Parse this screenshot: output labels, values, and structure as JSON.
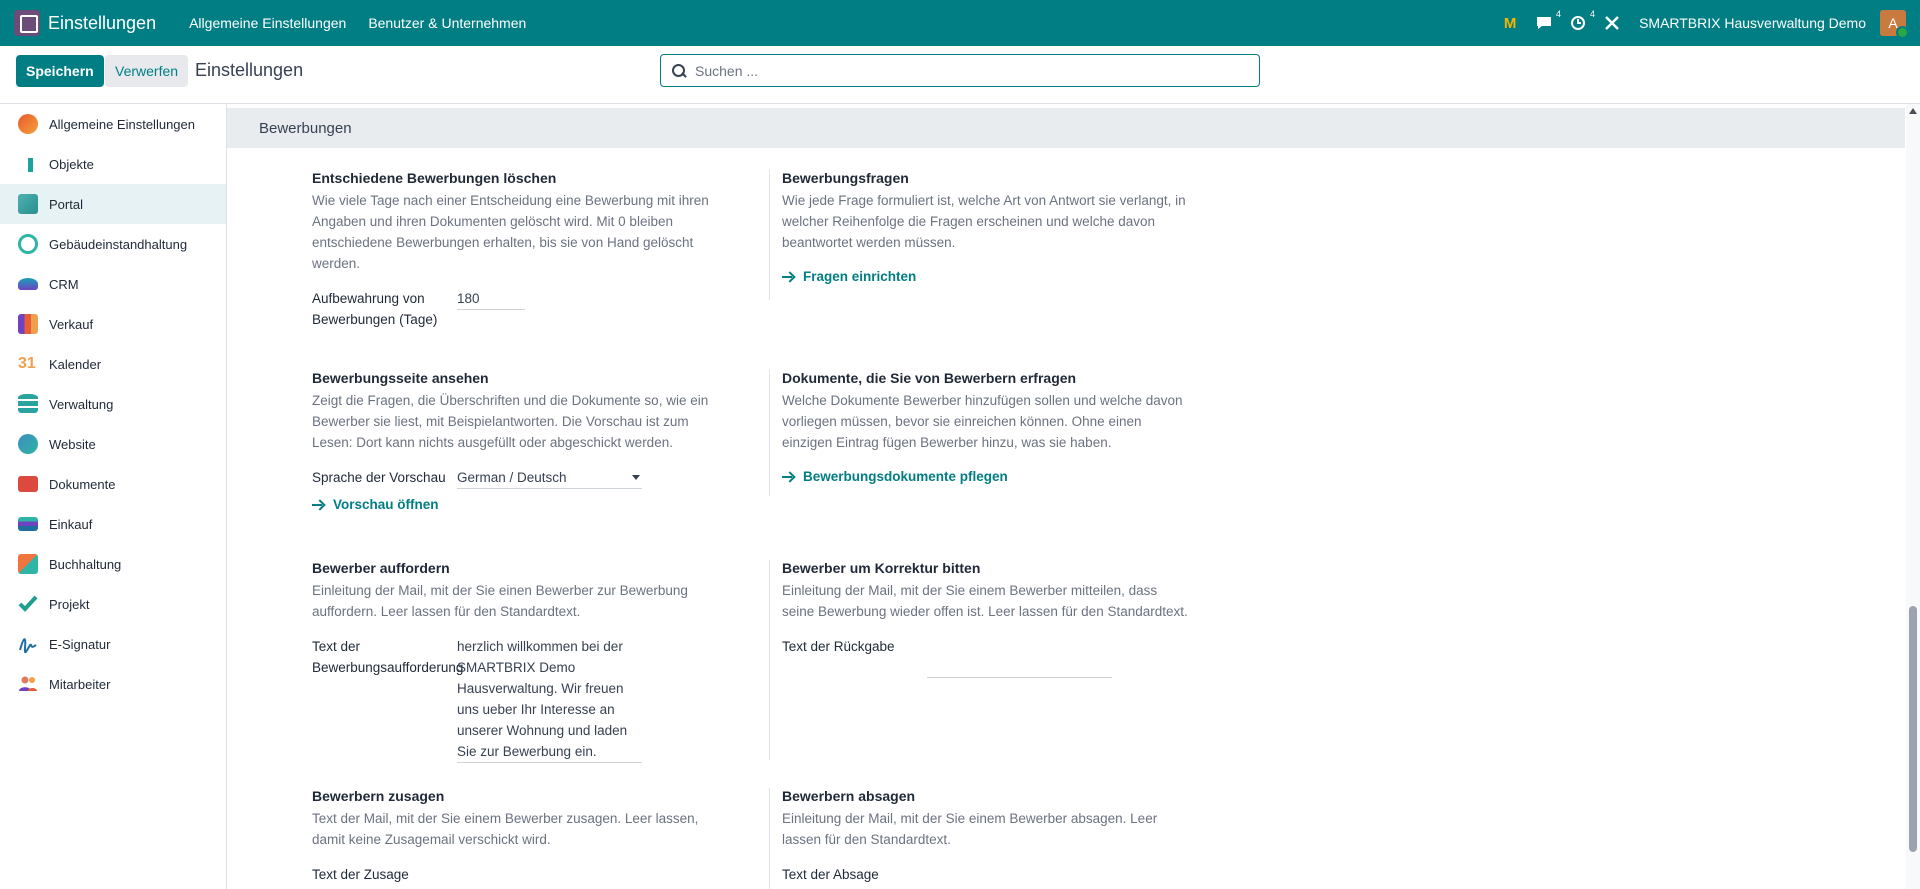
{
  "navbar": {
    "app_name": "Einstellungen",
    "menus": [
      "Allgemeine Einstellungen",
      "Benutzer & Unternehmen"
    ],
    "messages_count": "4",
    "activities_count": "4",
    "company": "SMARTBRIX Hausverwaltung Demo",
    "avatar_letter": "A"
  },
  "control": {
    "save_label": "Speichern",
    "discard_label": "Verwerfen",
    "title": "Einstellungen",
    "search_placeholder": "Suchen ..."
  },
  "sidebar": {
    "items": [
      {
        "label": "Allgemeine Einstellungen",
        "color": "#e8592b"
      },
      {
        "label": "Objekte",
        "color": "#1aa39e"
      },
      {
        "label": "Portal",
        "color": "#34a3a3"
      },
      {
        "label": "Gebäudeinstandhaltung",
        "color": "#2fb5a5"
      },
      {
        "label": "CRM",
        "color": "#17a2b8"
      },
      {
        "label": "Verkauf",
        "color": "#e85d35"
      },
      {
        "label": "Kalender",
        "color": "#f0a04b"
      },
      {
        "label": "Verwaltung",
        "color": "#28a39f"
      },
      {
        "label": "Website",
        "color": "#3c8dbc"
      },
      {
        "label": "Dokumente",
        "color": "#dc4a3f"
      },
      {
        "label": "Einkauf",
        "color": "#6f42c1"
      },
      {
        "label": "Buchhaltung",
        "color": "#f0743e"
      },
      {
        "label": "Projekt",
        "color": "#1e9e8f"
      },
      {
        "label": "E-Signatur",
        "color": "#1e6fa0"
      },
      {
        "label": "Mitarbeiter",
        "color": "#e07a5f"
      }
    ]
  },
  "section": {
    "title": "Bewerbungen"
  },
  "blocks": {
    "delete": {
      "title": "Entschiedene Bewerbungen löschen",
      "desc": "Wie viele Tage nach einer Entscheidung eine Bewerbung mit ihren Angaben und ihren Dokumenten gelöscht wird. Mit 0 bleiben entschiedene Bewerbungen erhalten, bis sie von Hand gelöscht werden.",
      "field_label": "Aufbewahrung von Bewerbungen (Tage)",
      "field_value": "180"
    },
    "questions": {
      "title": "Bewerbungsfragen",
      "desc": "Wie jede Frage formuliert ist, welche Art von Antwort sie verlangt, in welcher Reihenfolge die Fragen erscheinen und welche davon beantwortet werden müssen.",
      "link": "Fragen einrichten"
    },
    "preview": {
      "title": "Bewerbungsseite ansehen",
      "desc": "Zeigt die Fragen, die Überschriften und die Dokumente so, wie ein Bewerber sie liest, mit Beispielantworten. Die Vorschau ist zum Lesen: Dort kann nichts ausgefüllt oder abgeschickt werden.",
      "field_label": "Sprache der Vorschau",
      "field_value": "German / Deutsch",
      "link": "Vorschau öffnen"
    },
    "documents": {
      "title": "Dokumente, die Sie von Bewerbern erfragen",
      "desc": "Welche Dokumente Bewerber hinzufügen sollen und welche davon vorliegen müssen, bevor sie einreichen können. Ohne einen einzigen Eintrag fügen Bewerber hinzu, was sie haben.",
      "link": "Bewerbungsdokumente pflegen"
    },
    "invite": {
      "title": "Bewerber auffordern",
      "desc": "Einleitung der Mail, mit der Sie einen Bewerber zur Bewerbung auffordern. Leer lassen für den Standardtext.",
      "field_label": "Text der Bewerbungsaufforderung",
      "field_value": "herzlich willkommen bei der SMARTBRIX Demo Hausverwaltung. Wir freuen uns ueber Ihr Interesse an unserer Wohnung und laden Sie zur Bewerbung ein."
    },
    "correction": {
      "title": "Bewerber um Korrektur bitten",
      "desc": "Einleitung der Mail, mit der Sie einem Bewerber mitteilen, dass seine Bewerbung wieder offen ist. Leer lassen für den Standardtext.",
      "field_label": "Text der Rückgabe",
      "field_value": ""
    },
    "accept": {
      "title": "Bewerbern zusagen",
      "desc": "Text der Mail, mit der Sie einem Bewerber zusagen. Leer lassen, damit keine Zusagemail verschickt wird.",
      "field_label": "Text der Zusage"
    },
    "reject": {
      "title": "Bewerbern absagen",
      "desc": "Einleitung der Mail, mit der Sie einem Bewerber absagen. Leer lassen für den Standardtext.",
      "field_label": "Text der Absage"
    }
  }
}
